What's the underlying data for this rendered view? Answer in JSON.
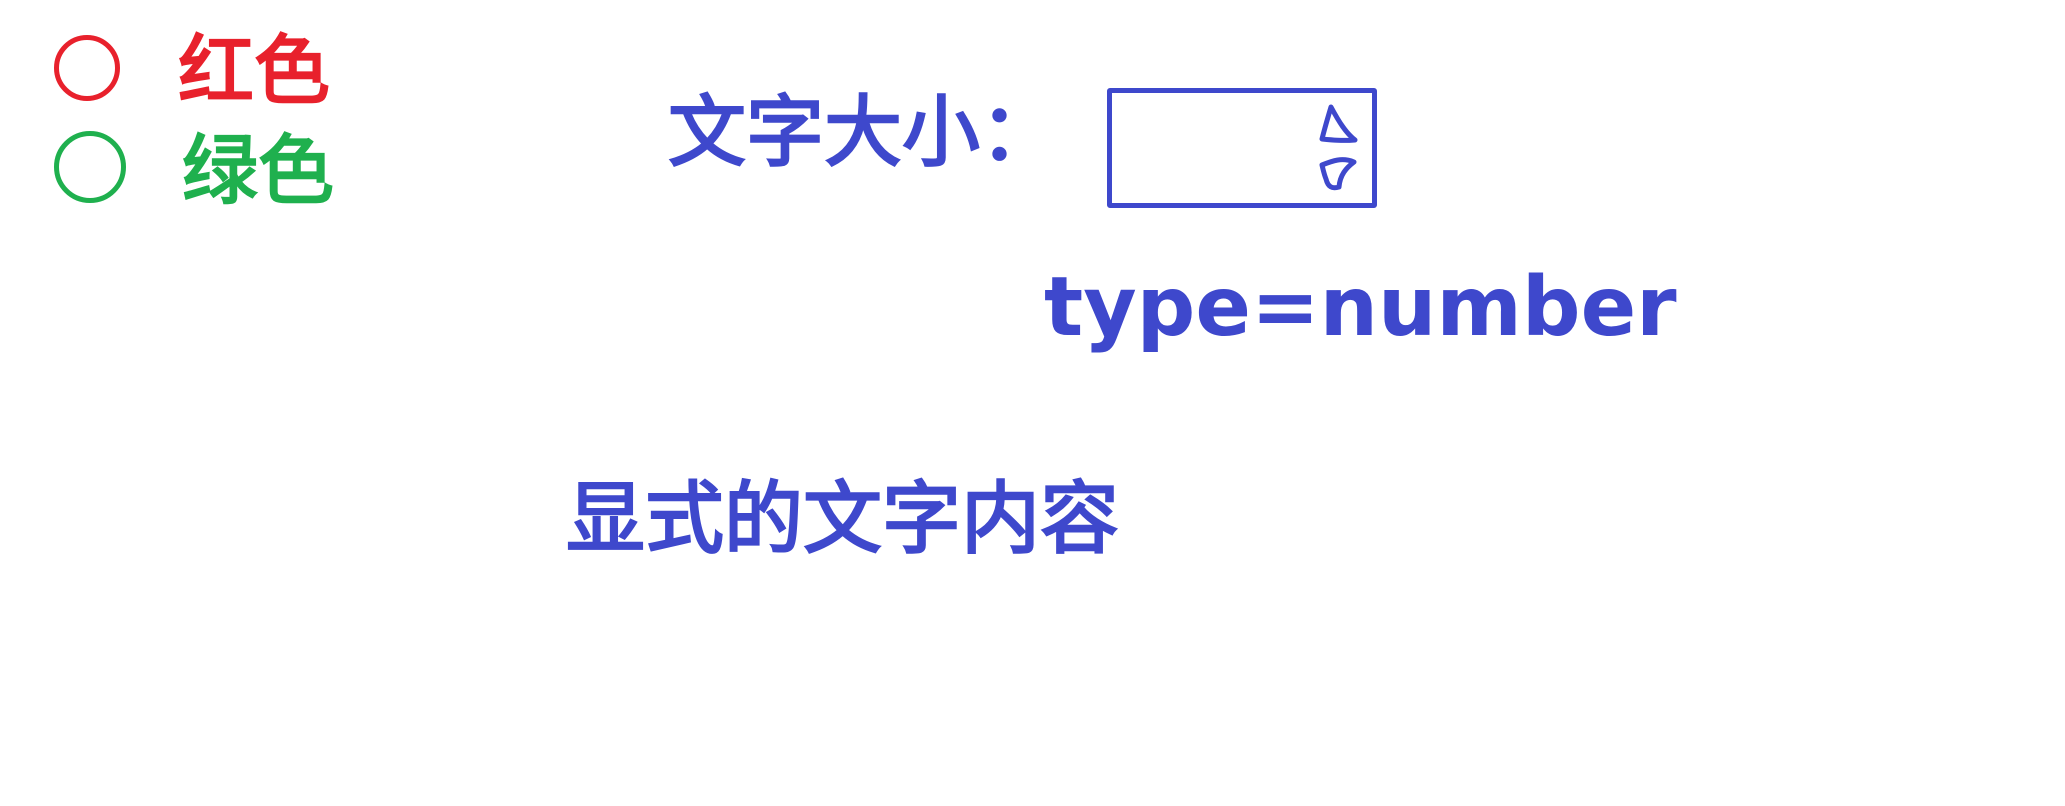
{
  "colors": {
    "red": "#e8212c",
    "green": "#1fb04e",
    "blue": "#3e48cc"
  },
  "color_options": [
    {
      "label": "红色",
      "color": "#e8212c",
      "selected": false
    },
    {
      "label": "绿色",
      "color": "#1fb04e",
      "selected": false
    }
  ],
  "font_size": {
    "label": "文字大小：",
    "input_value": "",
    "spinner_icons": [
      "arrow-up-icon",
      "arrow-down-icon"
    ]
  },
  "annotation": "type=number",
  "display_text": "显式的文字内容"
}
